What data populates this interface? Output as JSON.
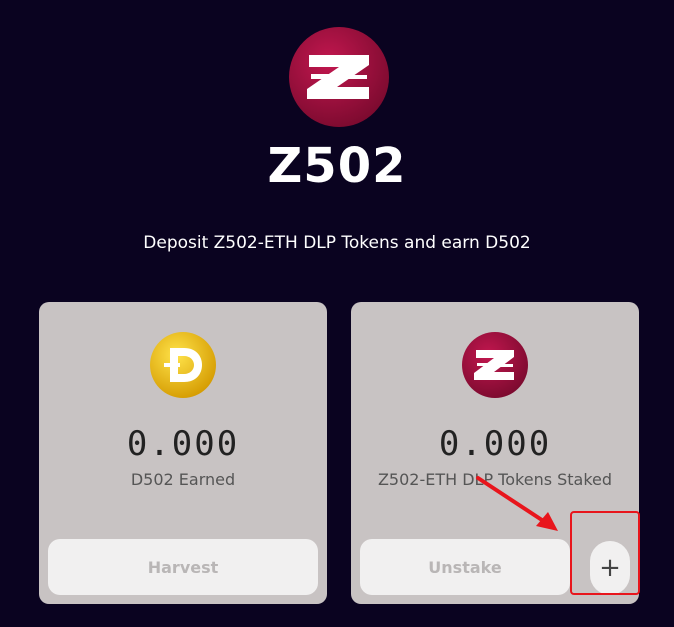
{
  "header": {
    "brand": "Z502",
    "subtitle": "Deposit Z502-ETH DLP Tokens and earn D502",
    "logo_icon": "z502-logo-icon"
  },
  "cards": [
    {
      "icon": "d502-coin-icon",
      "value": "0.000",
      "label": "D502 Earned",
      "button_label": "Harvest"
    },
    {
      "icon": "z502-coin-icon",
      "value": "0.000",
      "label": "Z502-ETH DLP Tokens Staked",
      "button_label": "Unstake",
      "plus_label": "+"
    }
  ],
  "colors": {
    "background": "#0a0320",
    "card": "#c8c3c3",
    "button": "#f1f0f0",
    "z502_brand": "#a0103f",
    "d502_gold": "#e6b400",
    "annotation_red": "#e8151c"
  }
}
